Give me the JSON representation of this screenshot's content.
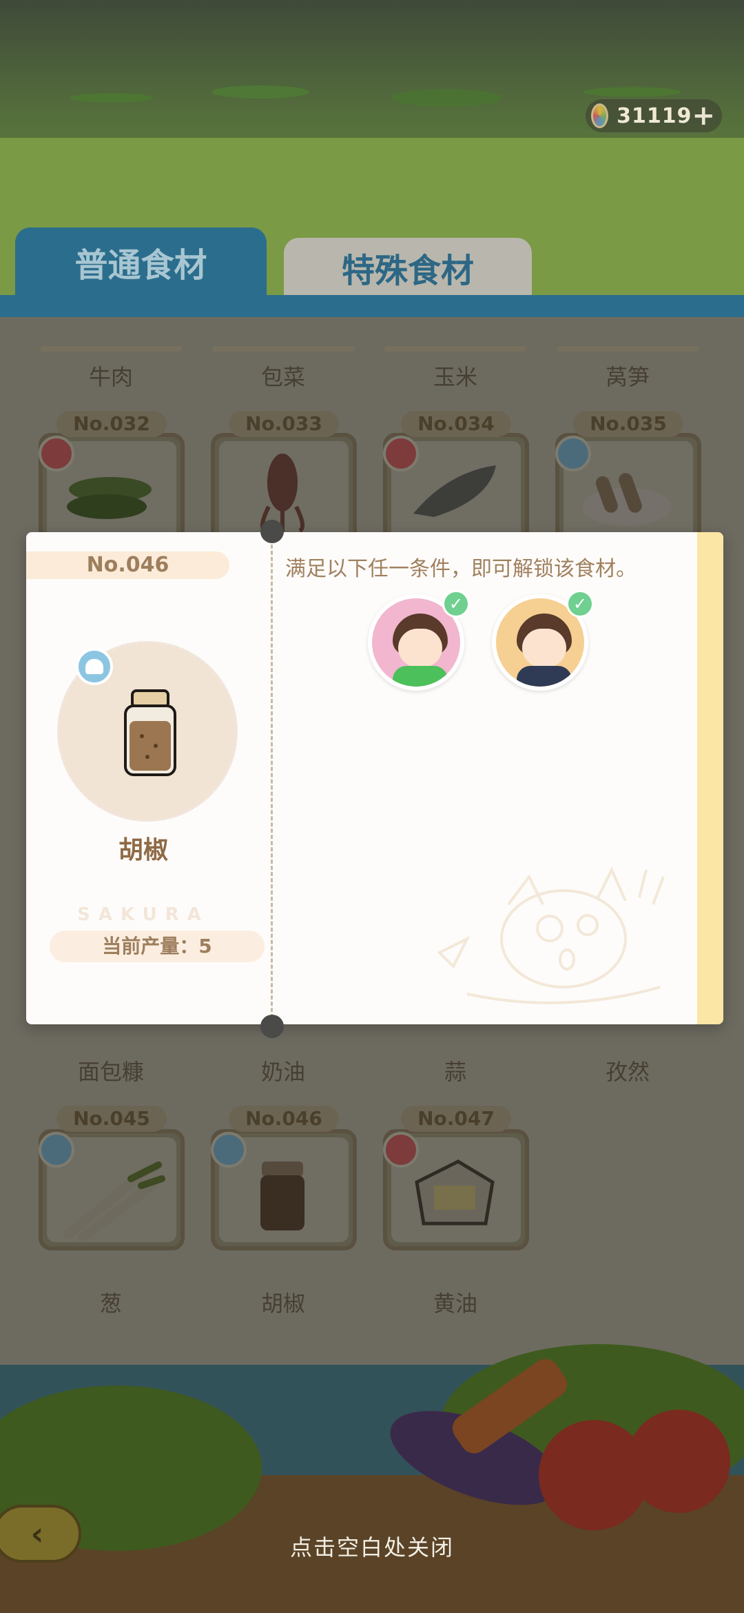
{
  "header": {
    "currency_value": "31119",
    "plus_label": "+"
  },
  "tabs": [
    {
      "label": "普通食材",
      "active": true
    },
    {
      "label": "特殊食材",
      "active": false
    }
  ],
  "grid": {
    "row1_labels": [
      "牛肉",
      "包菜",
      "玉米",
      "莴笋"
    ],
    "row2": [
      {
        "no": "No.032",
        "badge": "red"
      },
      {
        "no": "No.033",
        "badge": "none"
      },
      {
        "no": "No.034",
        "badge": "red"
      },
      {
        "no": "No.035",
        "badge": "blue"
      }
    ],
    "row3_labels": [
      "面包糠",
      "奶油",
      "蒜",
      "孜然"
    ],
    "row4": [
      {
        "no": "No.045",
        "badge": "blue",
        "label": "葱"
      },
      {
        "no": "No.046",
        "badge": "blue",
        "label": "胡椒"
      },
      {
        "no": "No.047",
        "badge": "red",
        "label": "黄油"
      }
    ]
  },
  "modal": {
    "no": "No.046",
    "item_name": "胡椒",
    "brand": "SAKURA",
    "output": "当前产量：5",
    "unlock_text": "满足以下任一条件，即可解锁该食材。",
    "conditions": [
      {
        "icon": "character-avatar-icon",
        "met": true
      },
      {
        "icon": "character-avatar-icon",
        "met": true
      }
    ]
  },
  "footer": {
    "close_hint": "点击空白处关闭"
  },
  "colors": {
    "tab_active": "#2b6d8c",
    "modal_stripe": "#fbe6a5",
    "check": "#6fd08f"
  }
}
